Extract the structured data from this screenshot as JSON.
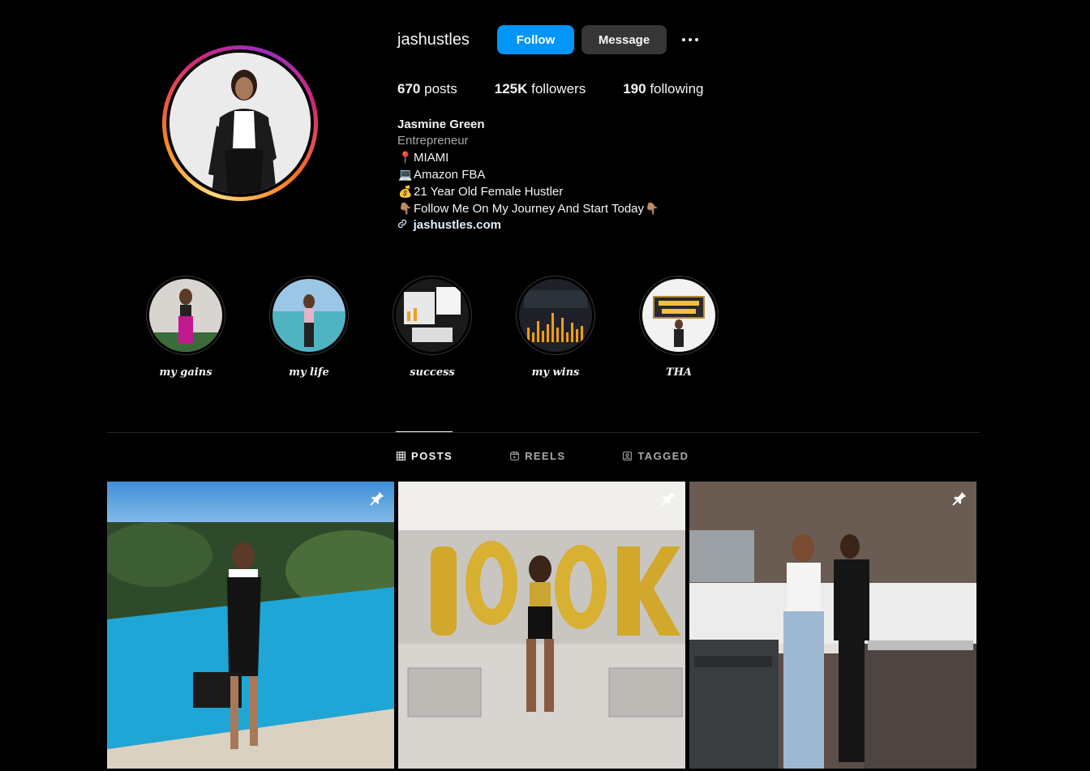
{
  "profile": {
    "username": "jashustles",
    "follow_label": "Follow",
    "message_label": "Message",
    "more_icon": "more-horizontal-icon"
  },
  "stats": {
    "posts_count": "670",
    "posts_label": "posts",
    "followers_count": "125K",
    "followers_label": "followers",
    "following_count": "190",
    "following_label": "following"
  },
  "bio": {
    "name": "Jasmine Green",
    "category": "Entrepreneur",
    "lines": [
      {
        "emoji": "📍",
        "text": "MIAMI"
      },
      {
        "emoji": "💻",
        "text": "Amazon FBA"
      },
      {
        "emoji": "💰",
        "text": "21 Year Old Female Hustler"
      },
      {
        "emoji": "👇🏽",
        "text": "Follow Me On My Journey And Start Today",
        "emoji_after": "👇🏽"
      }
    ],
    "link": "jashustles.com"
  },
  "highlights": [
    {
      "label": "my gains"
    },
    {
      "label": "my life"
    },
    {
      "label": "success"
    },
    {
      "label": "my wins"
    },
    {
      "label": "THA"
    }
  ],
  "tabs": [
    {
      "label": "POSTS",
      "icon": "grid-icon",
      "active": true
    },
    {
      "label": "REELS",
      "icon": "reels-icon",
      "active": false
    },
    {
      "label": "TAGGED",
      "icon": "tagged-icon",
      "active": false
    }
  ],
  "posts": [
    {
      "pinned": true,
      "subject": "pool-photo"
    },
    {
      "pinned": true,
      "subject": "100k-balloons-photo"
    },
    {
      "pinned": true,
      "subject": "kitchen-photo"
    }
  ],
  "colors": {
    "background": "#000000",
    "follow_button": "#0095f6",
    "message_button": "#363636",
    "link": "#e0f1ff",
    "muted": "#a8a8a8"
  }
}
